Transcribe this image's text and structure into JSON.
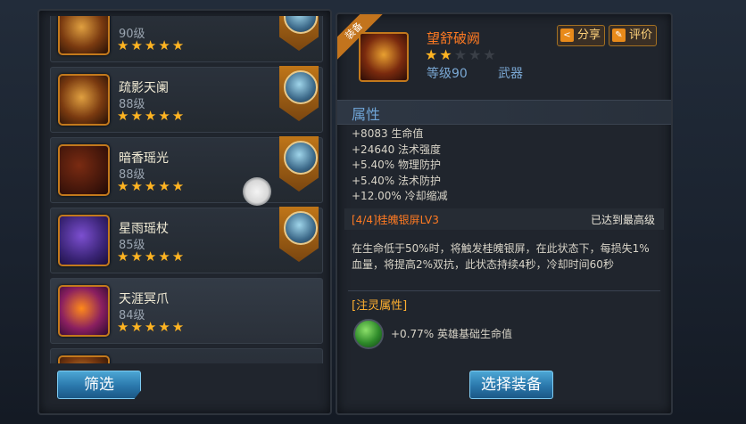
{
  "list": {
    "items": [
      {
        "name": "",
        "level": "90级",
        "stars": "★★★★★",
        "badge": true
      },
      {
        "name": "疏影天阑",
        "level": "88级",
        "stars": "★★★★★",
        "badge": true
      },
      {
        "name": "暗香瑶光",
        "level": "88级",
        "stars": "★★★★★",
        "badge": true
      },
      {
        "name": "星雨瑶杖",
        "level": "85级",
        "stars": "★★★★★",
        "badge": true
      },
      {
        "name": "天涯冥爪",
        "level": "84级",
        "stars": "★★★★★",
        "badge": false
      }
    ],
    "filter_label": "筛选"
  },
  "detail": {
    "ribbon": "装备",
    "name": "望舒破阙",
    "stars_filled": 2,
    "stars_total": 5,
    "level": "等级90",
    "type": "武器",
    "share_label": "分享",
    "rate_label": "评价",
    "section_title": "属性",
    "stats": [
      "+8083 生命值",
      "+24640 法术强度",
      "+5.40% 物理防护",
      "+5.40% 法术防护",
      "+12.00% 冷却缩减"
    ],
    "skill_name": "[4/4]桂魄银屏LV3",
    "skill_status": "已达到最高级",
    "skill_desc": "在生命低于50%时，将触发桂魄银屏，在此状态下，每损失1%血量，将提高2%双抗，此状态持续4秒，冷却时间60秒",
    "spirit_title": "[注灵属性]",
    "spirit_stat": "+0.77% 英雄基础生命值",
    "select_label": "选择装备"
  },
  "colors": {
    "accent_orange": "#ff7a22",
    "star_gold": "#ffb422",
    "info_blue": "#6fa4d6",
    "button_blue": "#2a77ab"
  }
}
